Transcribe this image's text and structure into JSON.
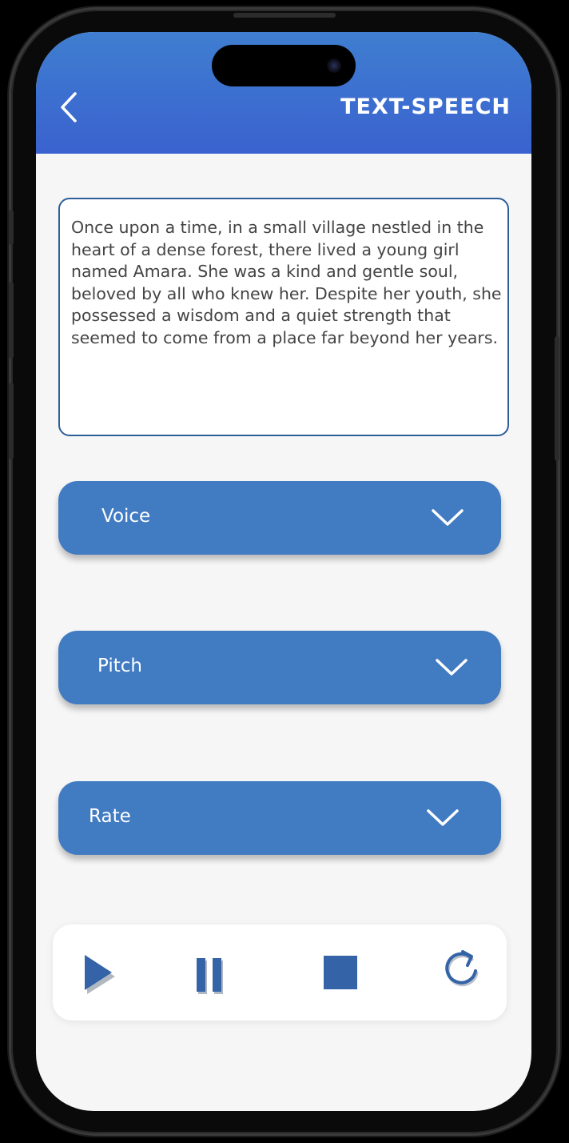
{
  "app": {
    "title": "TEXT-SPEECH"
  },
  "text_input": {
    "value": "Once upon a time, in a small village nestled in the heart of a dense forest, there lived a young girl named Amara. She was a kind and gentle soul, beloved by all who knew her. Despite her youth, she possessed a wisdom and a quiet strength that seemed to come from a place far beyond her years."
  },
  "dropdowns": {
    "voice": {
      "label": "Voice"
    },
    "pitch": {
      "label": "Pitch"
    },
    "rate": {
      "label": "Rate"
    }
  },
  "controls": {
    "play": {
      "icon": "play-icon"
    },
    "pause": {
      "icon": "pause-icon"
    },
    "stop": {
      "icon": "stop-icon"
    },
    "restart": {
      "icon": "refresh-icon"
    }
  },
  "colors": {
    "header_top": "#3f7ed0",
    "header_bottom": "#3a62cf",
    "dropdown_bg": "#417bc2",
    "control_icon": "#3463a8",
    "text_border": "#2e5f99"
  }
}
